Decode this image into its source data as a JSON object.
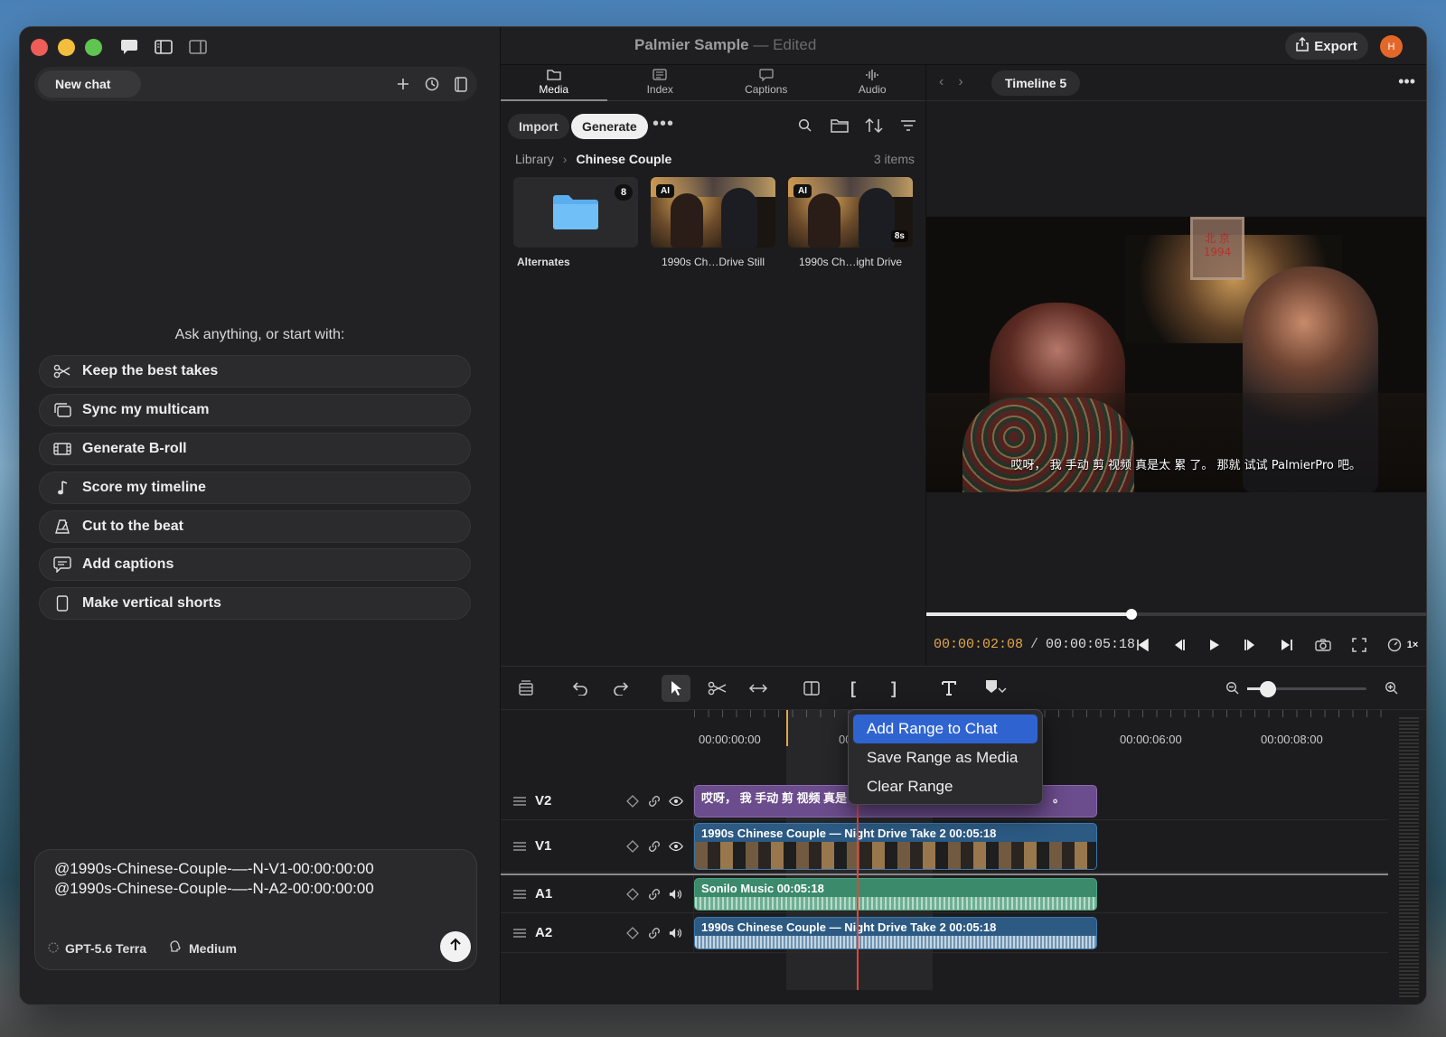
{
  "chat": {
    "tab_label": "New chat",
    "prompt": "Ask anything, or start with:",
    "suggestions": [
      {
        "label": "Keep the best takes",
        "icon": "scissors-icon"
      },
      {
        "label": "Sync my multicam",
        "icon": "multicam-icon"
      },
      {
        "label": "Generate B-roll",
        "icon": "film-icon"
      },
      {
        "label": "Score my timeline",
        "icon": "music-note-icon"
      },
      {
        "label": "Cut to the beat",
        "icon": "metronome-icon"
      },
      {
        "label": "Add captions",
        "icon": "caption-icon"
      },
      {
        "label": "Make vertical shorts",
        "icon": "vertical-frame-icon"
      }
    ],
    "composer": {
      "line1": "@1990s-Chinese-Couple-—-N-V1-00:00:00:00",
      "line2": "@1990s-Chinese-Couple-—-N-A2-00:00:00:00",
      "model": "GPT-5.6 Terra",
      "effort": "Medium"
    }
  },
  "title": {
    "project": "Palmier Sample",
    "sep": "—",
    "status": "Edited",
    "export_label": "Export",
    "avatar_initial": "H"
  },
  "media": {
    "tabs": [
      {
        "label": "Media",
        "active": true
      },
      {
        "label": "Index"
      },
      {
        "label": "Captions"
      },
      {
        "label": "Audio"
      }
    ],
    "import_label": "Import",
    "generate_label": "Generate",
    "more_label": "•••",
    "breadcrumb": {
      "root": "Library",
      "current": "Chinese Couple",
      "count": "3 items"
    },
    "items": [
      {
        "label": "Alternates",
        "badge": "8"
      },
      {
        "label": "1990s Ch…Drive Still",
        "badge": "AI"
      },
      {
        "label": "1990s Ch…ight Drive",
        "badge": "AI",
        "duration": "8s"
      }
    ]
  },
  "preview": {
    "timeline_label": "Timeline 5",
    "sign_text": "北 京\n1994",
    "subtitle": "哎呀， 我 手动 剪 视频 真是太 累 了。 那就 试试 PalmierPro 吧。",
    "current_tc": "00:00:02:08",
    "tc_sep": "/",
    "duration_tc": "00:00:05:18",
    "progress": 0.41,
    "speed_label": "1×"
  },
  "timeline": {
    "ruler_labels": [
      "00:00:00:00",
      "00:",
      "00:00:06:00",
      "00:00:08:00"
    ],
    "tracks": [
      {
        "name": "V2",
        "clip": "哎呀， 我 手动 剪 视频 真是",
        "clip_tail": "。"
      },
      {
        "name": "V1",
        "clip": "1990s Chinese Couple — Night Drive Take 2  00:05:18"
      },
      {
        "name": "A1",
        "clip": "Sonilo Music  00:05:18"
      },
      {
        "name": "A2",
        "clip": "1990s Chinese Couple — Night Drive Take 2  00:05:18"
      }
    ],
    "context_menu": [
      "Add Range to Chat",
      "Save Range as Media",
      "Clear Range"
    ]
  }
}
